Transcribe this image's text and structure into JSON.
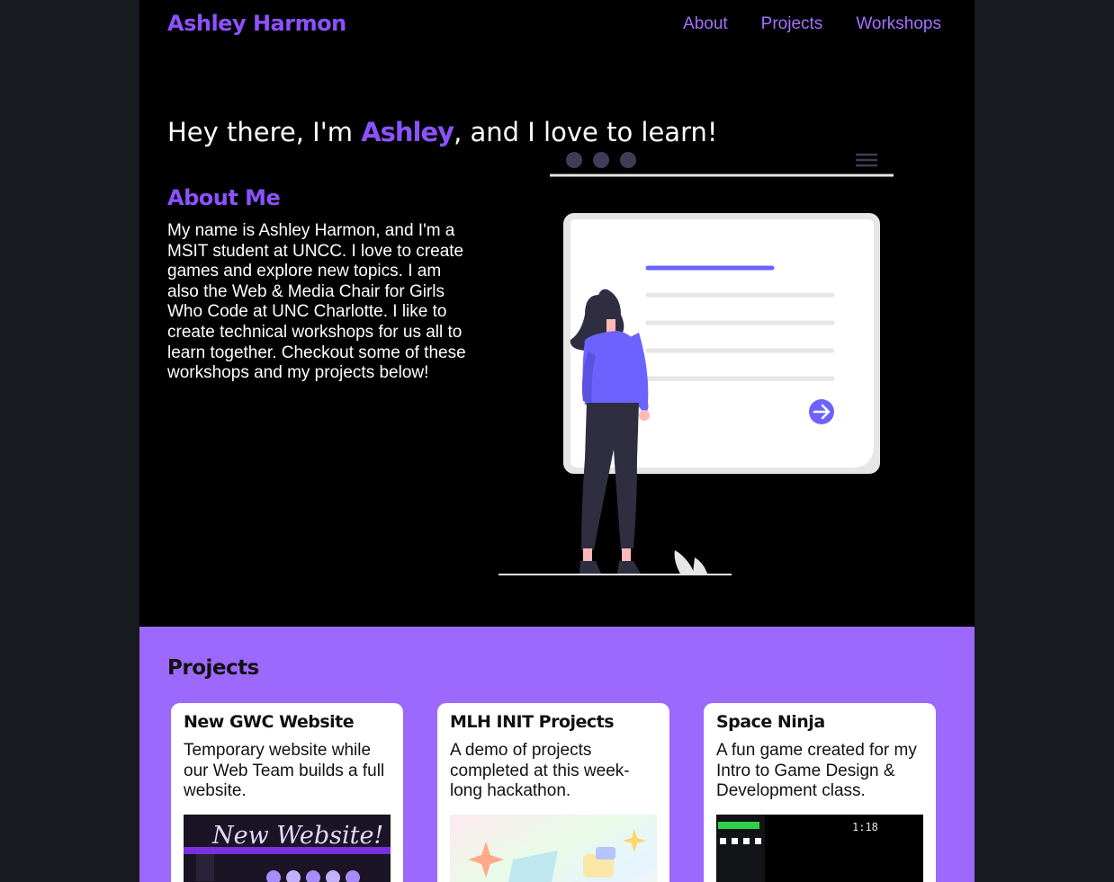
{
  "header": {
    "site_name": "Ashley Harmon",
    "nav": [
      {
        "label": "About"
      },
      {
        "label": "Projects"
      },
      {
        "label": "Workshops"
      }
    ]
  },
  "hero": {
    "title_before": "Hey there, I'm ",
    "title_name": "Ashley",
    "title_after": ", and I love to learn!"
  },
  "about": {
    "heading": "About Me",
    "text": "My name is Ashley Harmon, and I'm a MSIT student at UNCC. I love to create games and explore new topics. I am also the Web & Media Chair for Girls Who Code at UNC Charlotte. I like to create technical workshops for us all to learn together. Checkout some of these workshops and my projects below!"
  },
  "projects": {
    "heading": "Projects",
    "cards": [
      {
        "title": "New GWC Website",
        "description": "Temporary website while our Web Team builds a full website.",
        "thumb_text": "New Website!"
      },
      {
        "title": "MLH INIT Projects",
        "description": "A demo of projects completed at this week-long hackathon."
      },
      {
        "title": "Space Ninja",
        "description": "A fun game created for my Intro to Game Design & Development class.",
        "thumb_text": "1:18"
      }
    ]
  },
  "colors": {
    "accent": "#8c52ff",
    "projects_background": "#9d68fc",
    "page_background": "#000000"
  }
}
